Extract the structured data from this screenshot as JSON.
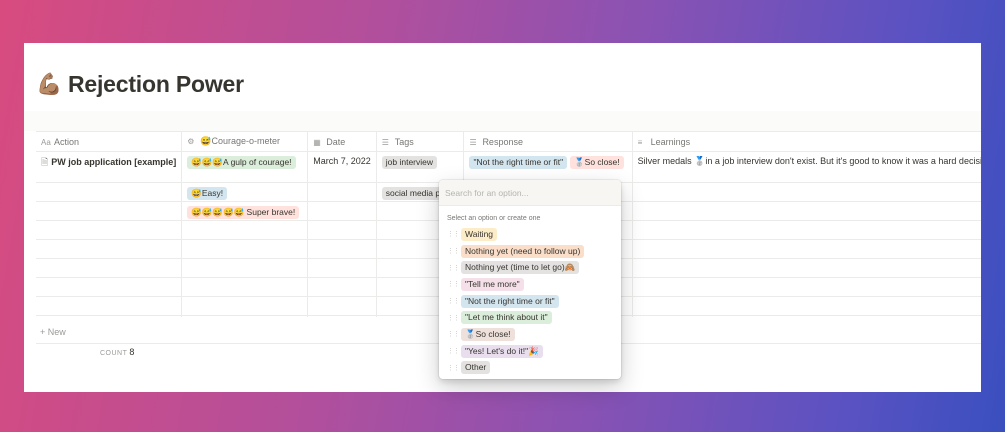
{
  "page": {
    "title": "Rejection Power",
    "title_icon": "💪🏽"
  },
  "table": {
    "columns": [
      {
        "label": "Action",
        "icon": "Aa"
      },
      {
        "label": "😅Courage-o-meter",
        "icon": "⚙"
      },
      {
        "label": "Date",
        "icon": "▦"
      },
      {
        "label": "Tags",
        "icon": "☰"
      },
      {
        "label": "Response",
        "icon": "☰"
      },
      {
        "label": "Learnings",
        "icon": "≡"
      }
    ],
    "rows": [
      {
        "action": "PW job application [example]",
        "courage": "😅😅😅A gulp of courage!",
        "date": "March 7, 2022",
        "tag": "job interview",
        "responses": [
          "\"Not the right time or fit\"",
          "🥈So close!"
        ],
        "learnings": "Silver medals 🥈in a job interview don't exist. But it's good to know it was a hard decision."
      },
      {
        "courage": "😅Easy!",
        "tag": "social media post"
      },
      {
        "courage": "😅😅😅😅😅 Super brave!"
      }
    ],
    "new_label": "New",
    "count_label": "COUNT",
    "count_value": "8"
  },
  "dropdown": {
    "placeholder": "Search for an option...",
    "hint": "Select an option or create one",
    "options": [
      {
        "label": "Waiting",
        "color": "#fdecc8"
      },
      {
        "label": "Nothing yet (need to follow up)",
        "color": "#fadec9"
      },
      {
        "label": "Nothing yet (time to let go)🙈",
        "color": "#e3e2e0"
      },
      {
        "label": "\"Tell me more\"",
        "color": "#f5e0e9"
      },
      {
        "label": "\"Not the right time or fit\"",
        "color": "#d3e5ef"
      },
      {
        "label": "\"Let me think about it\"",
        "color": "#dbeddb"
      },
      {
        "label": "🥈So close!",
        "color": "#eee0da"
      },
      {
        "label": "\"Yes! Let's do it!\"🎉",
        "color": "#e8deee"
      },
      {
        "label": "Other",
        "color": "#e3e2e0"
      }
    ]
  }
}
